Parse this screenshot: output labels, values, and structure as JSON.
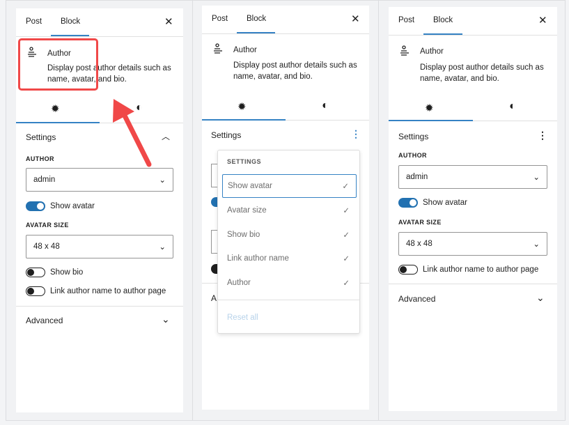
{
  "panels": [
    {
      "tabs": [
        "Post",
        "Block"
      ],
      "block": {
        "title": "Author",
        "description": "Display post author details such as name, avatar, and bio."
      },
      "settings": {
        "title": "Settings",
        "author_label": "AUTHOR",
        "author_value": "admin",
        "toggle_avatar": "Show avatar",
        "avatar_size_label": "AVATAR SIZE",
        "avatar_size_value": "48 x 48",
        "toggle_bio": "Show bio",
        "toggle_link": "Link author name to author page"
      },
      "advanced": "Advanced"
    },
    {
      "tabs": [
        "Post",
        "Block"
      ],
      "block": {
        "title": "Author",
        "description": "Display post author details such as name, avatar, and bio."
      },
      "settings": {
        "title": "Settings"
      },
      "advanced": "A"
    },
    {
      "tabs": [
        "Post",
        "Block"
      ],
      "block": {
        "title": "Author",
        "description": "Display post author details such as name, avatar, and bio."
      },
      "settings": {
        "title": "Settings",
        "author_label": "AUTHOR",
        "author_value": "admin",
        "toggle_avatar": "Show avatar",
        "avatar_size_label": "AVATAR SIZE",
        "avatar_size_value": "48 x 48",
        "toggle_link": "Link author name to author page"
      },
      "advanced": "Advanced"
    }
  ],
  "menu": {
    "heading": "SETTINGS",
    "items": [
      "Show avatar",
      "Avatar size",
      "Show bio",
      "Link author name",
      "Author"
    ],
    "reset": "Reset all"
  },
  "colors": {
    "accent": "#3582c4",
    "annotation": "#f04848"
  }
}
